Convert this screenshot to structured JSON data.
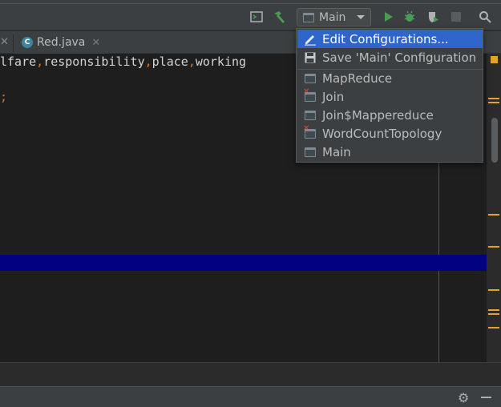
{
  "toolbar": {
    "run_config": "Main",
    "icons": [
      "terminal-icon",
      "build-hammer-icon",
      "run-icon",
      "debug-icon",
      "coverage-icon",
      "stop-icon",
      "search-icon"
    ]
  },
  "tabs": [
    {
      "name": "Red.java",
      "icon": "C"
    }
  ],
  "editor": {
    "line1": [
      "lfare",
      "responsibility",
      "place",
      "working"
    ],
    "line1_comma": ",",
    "line2": ";"
  },
  "dropdown": {
    "items": [
      {
        "label": "Edit Configurations...",
        "icon": "pencil-icon",
        "selected": true
      },
      {
        "label": "Save 'Main' Configuration",
        "icon": "save-icon",
        "selected": false
      },
      {
        "label": "MapReduce",
        "icon": "application-icon",
        "error": false
      },
      {
        "label": "Join",
        "icon": "application-icon",
        "error": true
      },
      {
        "label": "Join$Mappereduce",
        "icon": "application-icon",
        "error": false
      },
      {
        "label": "WordCountTopology",
        "icon": "application-icon",
        "error": true
      },
      {
        "label": "Main",
        "icon": "application-icon",
        "error": false
      }
    ]
  },
  "colors": {
    "accent_selected": "#2f65ca",
    "run_green": "#499c54",
    "marker_orange": "#e0a427",
    "selection_blue": "#000080",
    "comma": "#cc7832"
  }
}
